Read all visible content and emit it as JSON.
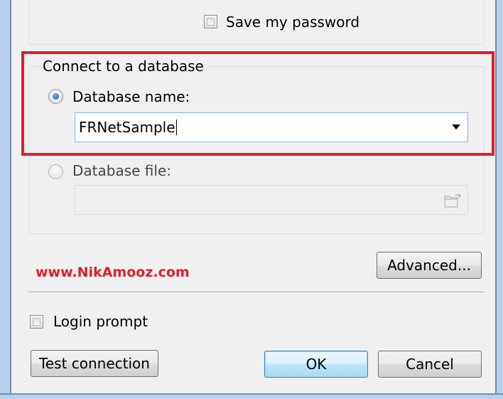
{
  "top_group": {
    "save_password_label": "Save my password",
    "save_password_checked": false
  },
  "database_group": {
    "title": "Connect to a database",
    "database_name_label": "Database name:",
    "database_name_selected": true,
    "database_name_value": "FRNetSample",
    "database_file_label": "Database file:",
    "database_file_selected": false,
    "database_file_value": "",
    "browse_icon": "folder-open-icon",
    "dropdown_icon": "chevron-down-icon"
  },
  "buttons": {
    "advanced_label": "Advanced...",
    "test_connection_label": "Test connection",
    "ok_label": "OK",
    "cancel_label": "Cancel"
  },
  "login_prompt": {
    "label": "Login prompt",
    "checked": false
  },
  "watermark": {
    "text": "www.NikAmooz.com"
  },
  "colors": {
    "highlight": "#e01e2b",
    "watermark": "#e01e2b",
    "dialog_bg": "#f0f0f0",
    "frame": "#b9d1ea"
  }
}
